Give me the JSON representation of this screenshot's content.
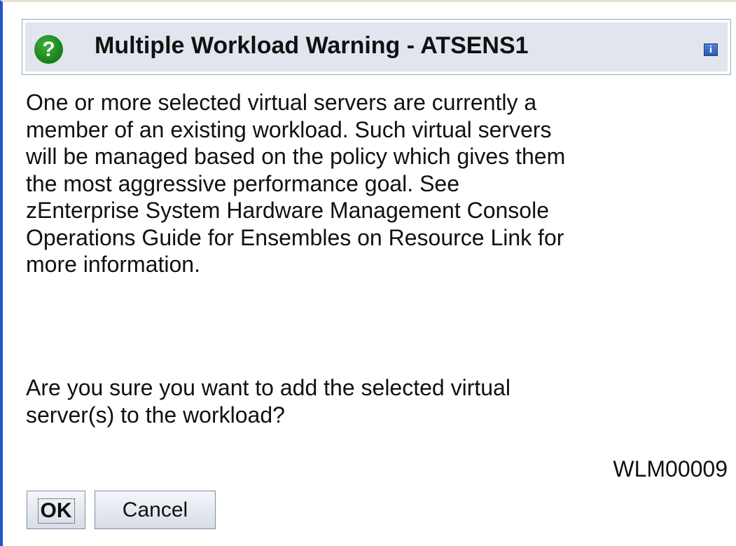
{
  "dialog": {
    "title": "Multiple Workload Warning - ATSENS1",
    "message_lines": [
      "One or more selected virtual servers are currently a",
      "member of an existing workload. Such virtual servers",
      "will be managed based on the policy which gives them",
      "the most aggressive performance goal. See",
      "zEnterprise System Hardware Management Console",
      "Operations Guide for Ensembles on Resource Link for",
      "more information."
    ],
    "question_lines": [
      "Are you sure you want to add the selected virtual",
      "server(s) to the workload?"
    ],
    "message_id": "WLM00009",
    "icons": {
      "help": "?",
      "info": "i"
    }
  },
  "buttons": {
    "ok_label": "OK",
    "cancel_label": "Cancel"
  },
  "colors": {
    "header_bg": "#e1e6ee",
    "help_icon": "#1f8a1f",
    "info_icon": "#2a5bb0",
    "window_left_border": "#2255cc"
  }
}
